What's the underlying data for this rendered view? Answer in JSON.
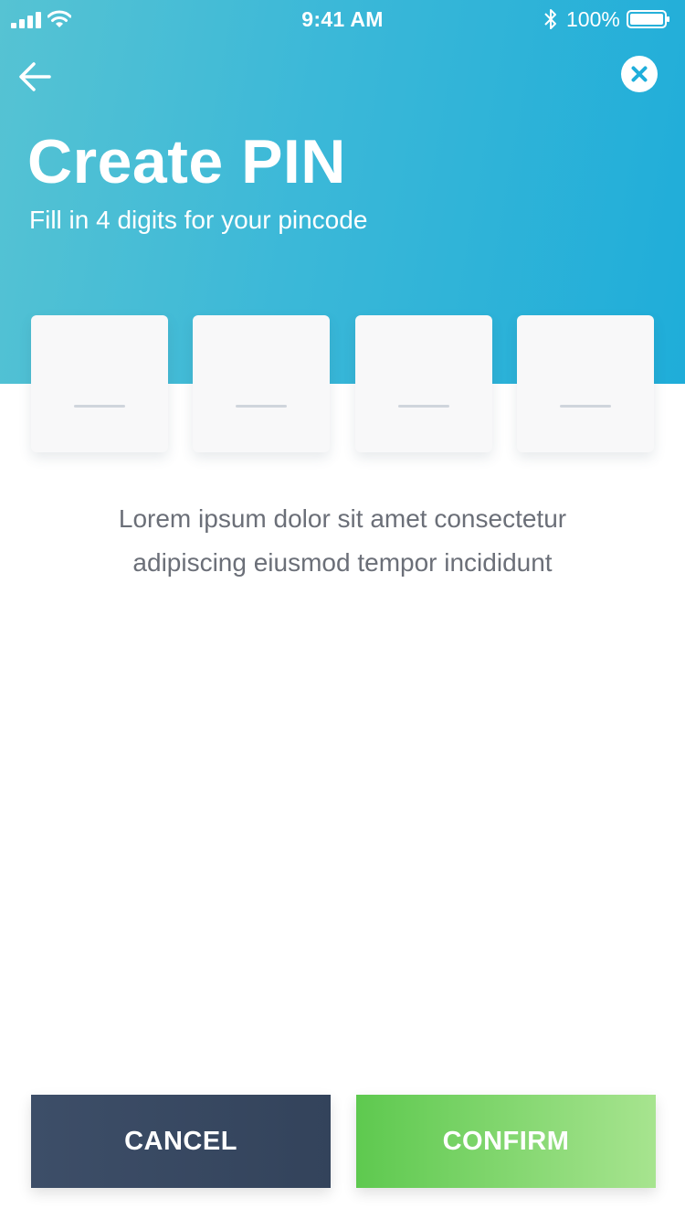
{
  "status_bar": {
    "time": "9:41 AM",
    "battery_percent": "100%",
    "icons": [
      "signal-icon",
      "wifi-icon",
      "bluetooth-icon",
      "battery-icon"
    ]
  },
  "header": {
    "title": "Create PIN",
    "subtitle": "Fill in 4 digits for your pincode",
    "back_icon": "arrow-left-icon",
    "close_icon": "close-circle-icon"
  },
  "pin": {
    "length": 4,
    "digits": [
      "",
      "",
      "",
      ""
    ]
  },
  "description": {
    "line1": "Lorem ipsum dolor sit amet consectetur",
    "line2": "adipiscing eiusmod tempor incididunt"
  },
  "actions": {
    "cancel_label": "CANCEL",
    "confirm_label": "CONFIRM"
  },
  "colors": {
    "header_gradient_start": "#56c3d3",
    "header_gradient_end": "#1fadd9",
    "cancel_bg": "#3a4a63",
    "confirm_gradient_start": "#5ec94f",
    "confirm_gradient_end": "#a7e48f",
    "text_muted": "#6b6f78"
  }
}
